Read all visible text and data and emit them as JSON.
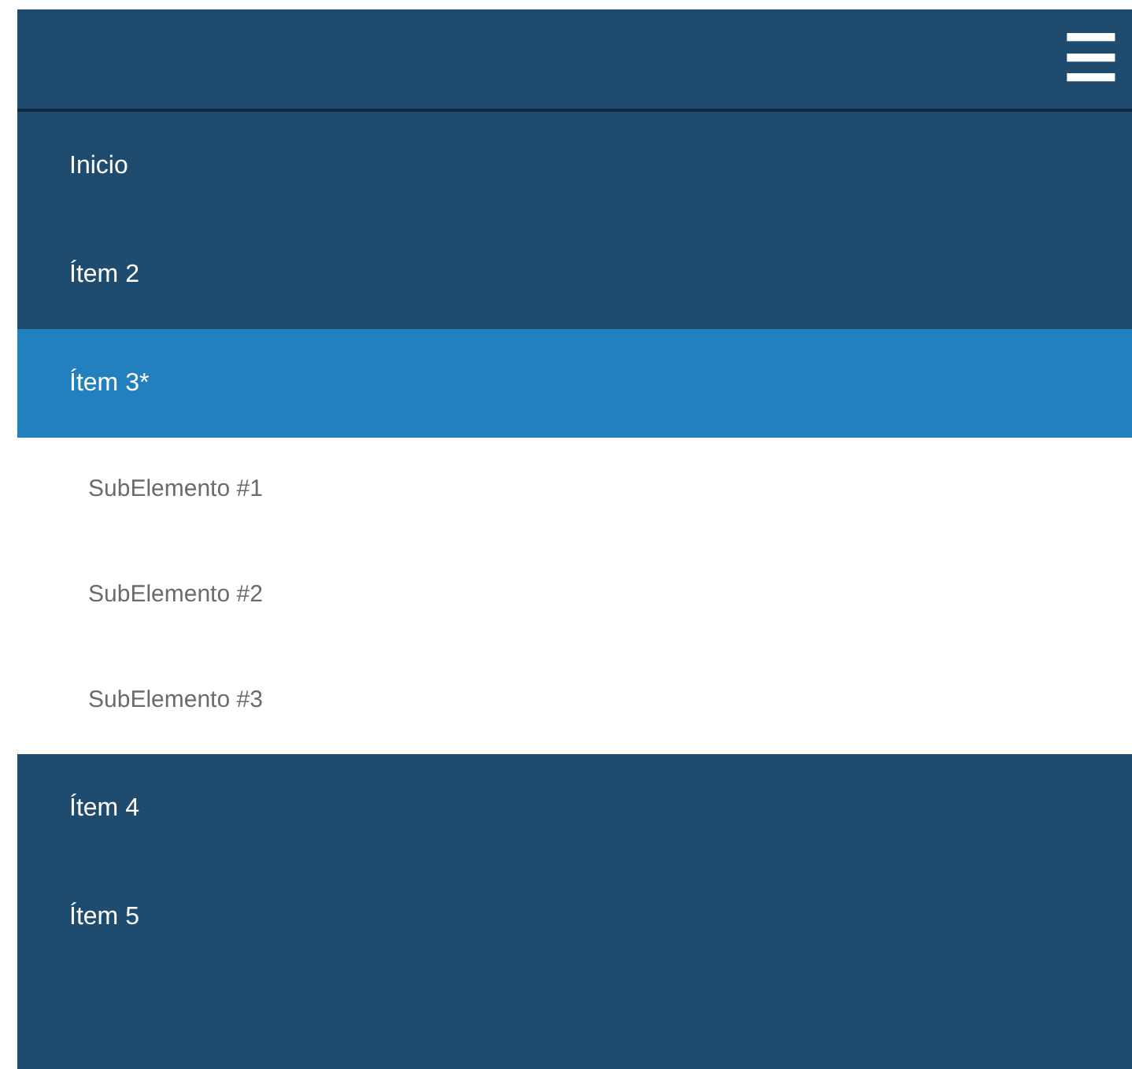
{
  "header": {
    "menu_button": "☰"
  },
  "menu": {
    "items": [
      {
        "label": "Inicio",
        "selected": false
      },
      {
        "label": "Ítem 2",
        "selected": false
      },
      {
        "label": "Ítem 3*",
        "selected": true,
        "expanded": true,
        "children": [
          {
            "label": "SubElemento #1"
          },
          {
            "label": "SubElemento #2"
          },
          {
            "label": "SubElemento #3"
          }
        ]
      },
      {
        "label": "Ítem 4",
        "selected": false
      },
      {
        "label": "Ítem 5",
        "selected": false
      }
    ]
  }
}
